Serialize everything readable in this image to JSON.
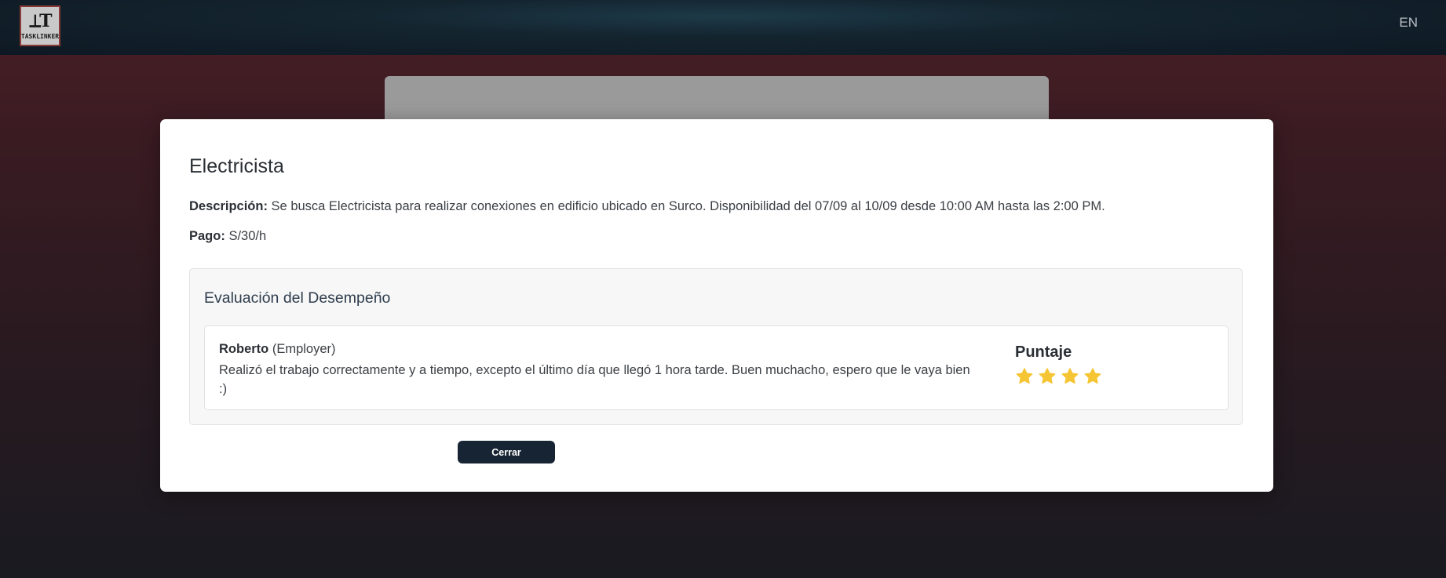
{
  "header": {
    "logo_glyph": "⟂T",
    "logo_text": "TASKLINKER",
    "language": "EN"
  },
  "modal": {
    "title": "Electricista",
    "description_label": "Descripción:",
    "description": "Se busca Electricista para realizar conexiones en edificio ubicado en Surco. Disponibilidad del 07/09 al 10/09 desde 10:00 AM hasta las 2:00 PM.",
    "payment_label": "Pago:",
    "payment": "S/30/h",
    "evaluation": {
      "title": "Evaluación del Desempeño",
      "review": {
        "reviewer_name": "Roberto",
        "reviewer_role": "(Employer)",
        "comment": "Realizó el trabajo correctamente y a tiempo, excepto el último día que llegó 1 hora tarde. Buen muchacho, espero que le vaya bien :)",
        "score_label": "Puntaje",
        "stars": 4,
        "star_icon": "star-icon",
        "star_color": "#f5c534"
      }
    },
    "close_label": "Cerrar"
  },
  "colors": {
    "topbar": "#142530",
    "button": "#162433",
    "backdrop_card": "#9a9a9a"
  }
}
